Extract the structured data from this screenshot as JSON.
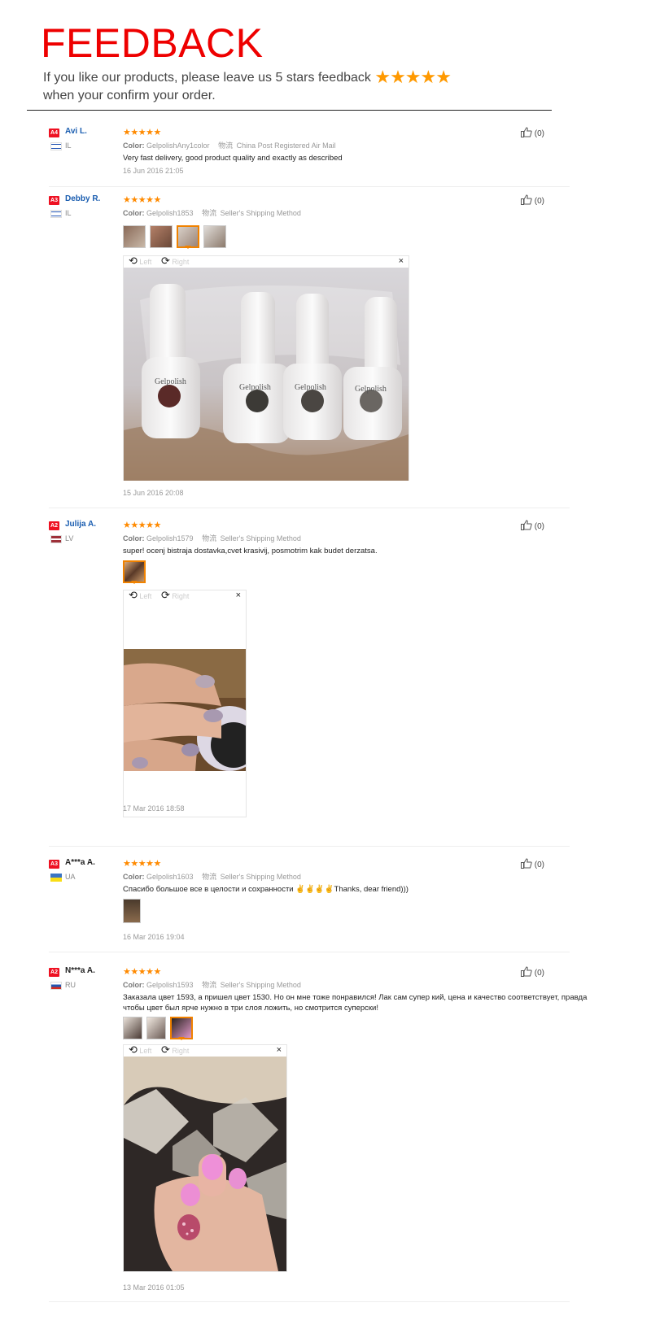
{
  "header": {
    "title": "FEEDBACK",
    "line1": "If you like our products, please leave us 5 stars feedback",
    "stars": "★★★★★",
    "line2": "when your confirm your order."
  },
  "labels": {
    "color": "Color:",
    "left": "Left",
    "right": "Right",
    "close": "×",
    "like_count": "(0)",
    "stars": "★★★★★",
    "ship_icon": "物流"
  },
  "reviews": [
    {
      "level": "A4",
      "name": "Avi L.",
      "country": "IL",
      "color": "GelpolishAny1color",
      "shipping": "China Post Registered Air Mail",
      "text": "Very fast delivery, good product quality and exactly as described",
      "date": "16 Jun 2016 21:05"
    },
    {
      "level": "A3",
      "name": "Debby R.",
      "country": "IL",
      "color": "Gelpolish1853",
      "shipping": "Seller's Shipping Method",
      "text": "",
      "date": "15 Jun 2016 20:08"
    },
    {
      "level": "A2",
      "name": "Julija A.",
      "country": "LV",
      "color": "Gelpolish1579",
      "shipping": "Seller's Shipping Method",
      "text": "super! ocenj bistraja dostavka,cvet krasivij, posmotrim kak budet derzatsa.",
      "date": "17 Mar 2016 18:58"
    },
    {
      "level": "A3",
      "name": "A***a A.",
      "country": "UA",
      "color": "Gelpolish1603",
      "shipping": "Seller's Shipping Method",
      "text": "Спасибо большое все в целости и сохранности ✌✌✌✌Thanks, dear friend)))",
      "date": "16 Mar 2016 19:04"
    },
    {
      "level": "A2",
      "name": "N***a A.",
      "country": "RU",
      "color": "Gelpolish1593",
      "shipping": "Seller's Shipping Method",
      "text": "Заказала цвет 1593, а пришел цвет 1530. Но он мне тоже понравился! Лак сам супер кий, цена и качество соответствует, правда чтобы цвет был ярче нужно в три слоя ложить, но смотрится суперски!",
      "date": "13 Mar 2016 01:05"
    }
  ],
  "colors": {
    "title_red": "#ee0000",
    "star_orange": "#ff8a00",
    "name_blue": "#1a5db0",
    "badge_red": "#ee1122"
  }
}
